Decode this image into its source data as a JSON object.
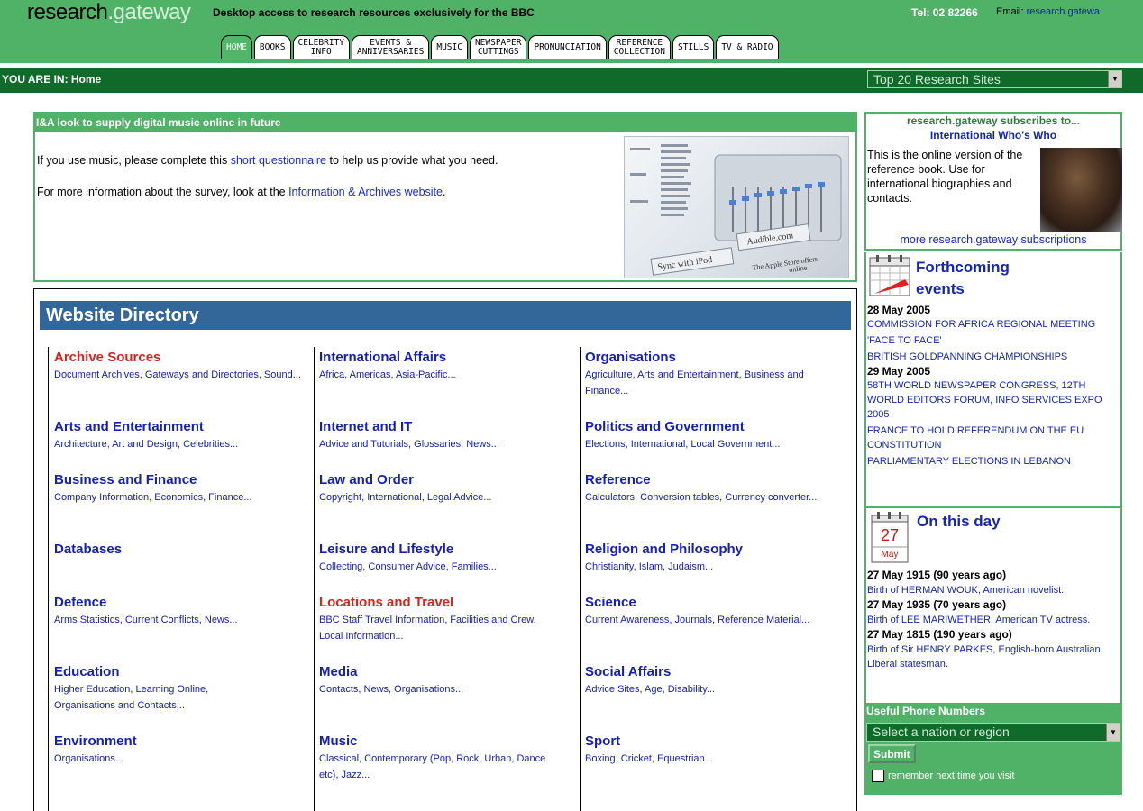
{
  "header": {
    "logo_part1": "research",
    "logo_part2": ".gateway",
    "tagline": "Desktop access to research resources exclusively for the BBC",
    "tel": "Tel: 02 82266",
    "email_label": "Email:",
    "email_link": "research.gatewa"
  },
  "tabs": [
    {
      "label": "HOME",
      "active": true
    },
    {
      "label": "BOOKS"
    },
    {
      "label": "CELEBRITY\nINFO"
    },
    {
      "label": "EVENTS &\nANNIVERSARIES"
    },
    {
      "label": "MUSIC"
    },
    {
      "label": "NEWSPAPER\nCUTTINGS"
    },
    {
      "label": "PRONUNCIATION"
    },
    {
      "label": "REFERENCE\nCOLLECTION"
    },
    {
      "label": "STILLS"
    },
    {
      "label": "TV & RADIO"
    }
  ],
  "nav": {
    "you_are_in": "YOU ARE IN: Home",
    "top_sites_select": "Top 20 Research Sites"
  },
  "survey": {
    "heading": "I&A look to supply digital music online in future",
    "p1_before": "If you use music, please complete this ",
    "p1_link": "short questionnaire",
    "p1_after": " to help us provide what you need.",
    "p2_before": "For more information about the survey, look at the ",
    "p2_link": "Information & Archives website",
    "p2_after": ".",
    "image_text_1": "Sync with iPod",
    "image_text_2": "Audible.com",
    "image_text_3": "The Apple Store offers",
    "image_text_4": "online"
  },
  "directory": {
    "title": "Website Directory",
    "columns": [
      [
        {
          "head": "Archive Sources",
          "sub": "Document Archives, Gateways and Directories, Sound...",
          "red": true
        },
        {
          "head": "Arts and Entertainment",
          "sub": "Architecture, Art and Design, Celebrities..."
        },
        {
          "head": "Business and Finance",
          "sub": "Company Information, Economics, Finance..."
        },
        {
          "head": "Databases",
          "sub": ""
        },
        {
          "head": "Defence",
          "sub": "Arms Statistics, Current Conflicts, News..."
        },
        {
          "head": "Education",
          "sub": "Higher Education, Learning Online, Organisations and Contacts..."
        },
        {
          "head": "Environment",
          "sub": "Organisations..."
        }
      ],
      [
        {
          "head": "International Affairs",
          "sub": "Africa, Americas, Asia-Pacific..."
        },
        {
          "head": "Internet and IT",
          "sub": "Advice and Tutorials, Glossaries, News..."
        },
        {
          "head": "Law and Order",
          "sub": "Copyright, International, Legal Advice..."
        },
        {
          "head": "Leisure and Lifestyle",
          "sub": "Collecting, Consumer Advice, Families..."
        },
        {
          "head": "Locations and Travel",
          "sub": "BBC Staff Travel Information, Facilities and Crew, Local Information...",
          "red": true
        },
        {
          "head": "Media",
          "sub": "Contacts, News, Organisations..."
        },
        {
          "head": "Music",
          "sub": "Classical, Contemporary (Pop, Rock, Urban, Dance etc), Jazz..."
        }
      ],
      [
        {
          "head": "Organisations",
          "sub": "Agriculture, Arts and Entertainment, Business and Finance..."
        },
        {
          "head": "Politics and Government",
          "sub": "Elections, International, Local Government..."
        },
        {
          "head": "Reference",
          "sub": "Calculators, Conversion tables, Currency converter..."
        },
        {
          "head": "Religion and Philosophy",
          "sub": "Christianity, Islam, Judaism..."
        },
        {
          "head": "Science",
          "sub": "Current Awareness, Journals, Reference Material..."
        },
        {
          "head": "Social Affairs",
          "sub": "Advice Sites, Age, Disability..."
        },
        {
          "head": "Sport",
          "sub": "Boxing, Cricket, Equestrian..."
        }
      ]
    ]
  },
  "subscriptions": {
    "title": "research.gateway subscribes to...",
    "name": "International Who's Who",
    "desc": "This is the online version of the reference book. Use for international biographies and contacts.",
    "more": "more research.gateway subscriptions"
  },
  "events": {
    "title": "Forthcoming events",
    "groups": [
      {
        "date": "28 May 2005",
        "items": [
          "COMMISSION FOR AFRICA REGIONAL MEETING",
          "'FACE TO FACE'",
          "BRITISH GOLDPANNING CHAMPIONSHIPS"
        ]
      },
      {
        "date": "29 May 2005",
        "items": [
          "58TH WORLD NEWSPAPER CONGRESS, 12TH WORLD EDITORS FORUM, INFO SERVICES EXPO 2005",
          "FRANCE TO HOLD REFERENDUM ON THE EU CONSTITUTION",
          "PARLIAMENTARY ELECTIONS IN LEBANON"
        ]
      }
    ]
  },
  "on_this_day": {
    "title": "On this day",
    "day": "27",
    "month": "May",
    "entries": [
      {
        "date": "27 May 1915 (90 years ago)",
        "text": "Birth of HERMAN WOUK, American novelist."
      },
      {
        "date": "27 May 1935 (70 years ago)",
        "text": "Birth of LEE MARIWETHER, American TV actress."
      },
      {
        "date": "27 May 1815 (190 years ago)",
        "text": "Birth of Sir HENRY PARKES, English-born Australian Liberal statesman."
      }
    ]
  },
  "phone": {
    "title": "Useful Phone Numbers",
    "select": "Select a nation or region",
    "submit": "Submit",
    "remember": "remember next time you visit"
  },
  "colors": {
    "header_green": "#4fb266",
    "dark_green": "#106a2a",
    "directory_blue": "#336699",
    "link_blue": "#1620b5",
    "highlight_red": "#d9231b"
  }
}
